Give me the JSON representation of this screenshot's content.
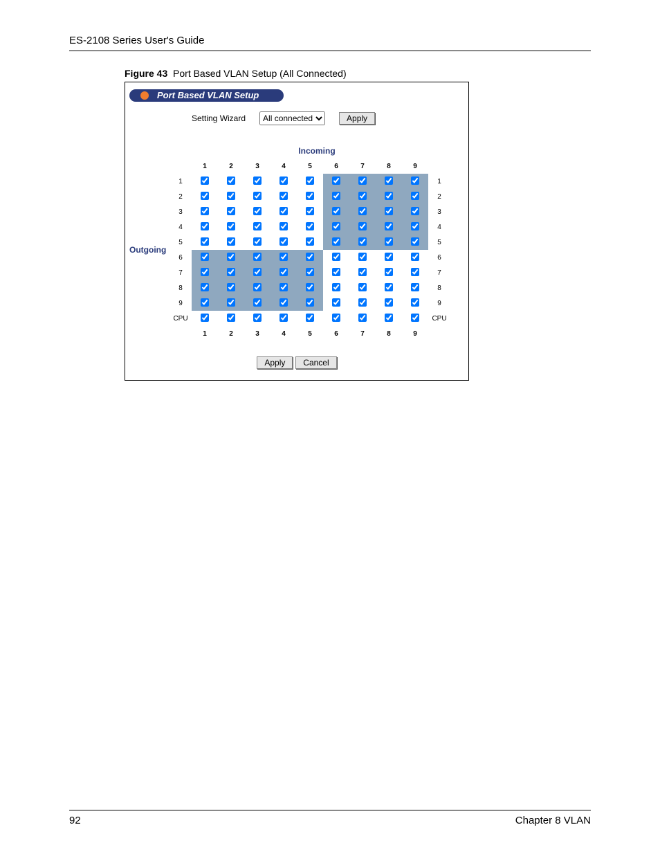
{
  "doc_header": "ES-2108 Series User's Guide",
  "figure_label": "Figure 43",
  "figure_title": "Port Based VLAN Setup (All Connected)",
  "panel_title": "Port Based VLAN Setup",
  "wizard": {
    "label": "Setting Wizard",
    "selected": "All connected",
    "apply": "Apply"
  },
  "incoming_label": "Incoming",
  "outgoing_label": "Outgoing",
  "col_headers": [
    "1",
    "2",
    "3",
    "4",
    "5",
    "6",
    "7",
    "8",
    "9"
  ],
  "rows": [
    {
      "label": "1",
      "checks": [
        1,
        1,
        1,
        1,
        1,
        1,
        1,
        1,
        1
      ],
      "shade": [
        0,
        0,
        0,
        0,
        0,
        1,
        1,
        1,
        1
      ]
    },
    {
      "label": "2",
      "checks": [
        1,
        1,
        1,
        1,
        1,
        1,
        1,
        1,
        1
      ],
      "shade": [
        0,
        0,
        0,
        0,
        0,
        1,
        1,
        1,
        1
      ]
    },
    {
      "label": "3",
      "checks": [
        1,
        1,
        1,
        1,
        1,
        1,
        1,
        1,
        1
      ],
      "shade": [
        0,
        0,
        0,
        0,
        0,
        1,
        1,
        1,
        1
      ]
    },
    {
      "label": "4",
      "checks": [
        1,
        1,
        1,
        1,
        1,
        1,
        1,
        1,
        1
      ],
      "shade": [
        0,
        0,
        0,
        0,
        0,
        1,
        1,
        1,
        1
      ]
    },
    {
      "label": "5",
      "checks": [
        1,
        1,
        1,
        1,
        1,
        1,
        1,
        1,
        1
      ],
      "shade": [
        0,
        0,
        0,
        0,
        0,
        1,
        1,
        1,
        1
      ]
    },
    {
      "label": "6",
      "checks": [
        1,
        1,
        1,
        1,
        1,
        1,
        1,
        1,
        1
      ],
      "shade": [
        1,
        1,
        1,
        1,
        1,
        0,
        0,
        0,
        0
      ]
    },
    {
      "label": "7",
      "checks": [
        1,
        1,
        1,
        1,
        1,
        1,
        1,
        1,
        1
      ],
      "shade": [
        1,
        1,
        1,
        1,
        1,
        0,
        0,
        0,
        0
      ]
    },
    {
      "label": "8",
      "checks": [
        1,
        1,
        1,
        1,
        1,
        1,
        1,
        1,
        1
      ],
      "shade": [
        1,
        1,
        1,
        1,
        1,
        0,
        0,
        0,
        0
      ]
    },
    {
      "label": "9",
      "checks": [
        1,
        1,
        1,
        1,
        1,
        1,
        1,
        1,
        1
      ],
      "shade": [
        1,
        1,
        1,
        1,
        1,
        0,
        0,
        0,
        0
      ]
    },
    {
      "label": "CPU",
      "checks": [
        1,
        1,
        1,
        1,
        1,
        1,
        1,
        1,
        1
      ],
      "shade": [
        0,
        0,
        0,
        0,
        0,
        0,
        0,
        0,
        0
      ]
    }
  ],
  "foot_apply": "Apply",
  "foot_cancel": "Cancel",
  "page_number": "92",
  "chapter": "Chapter 8 VLAN"
}
